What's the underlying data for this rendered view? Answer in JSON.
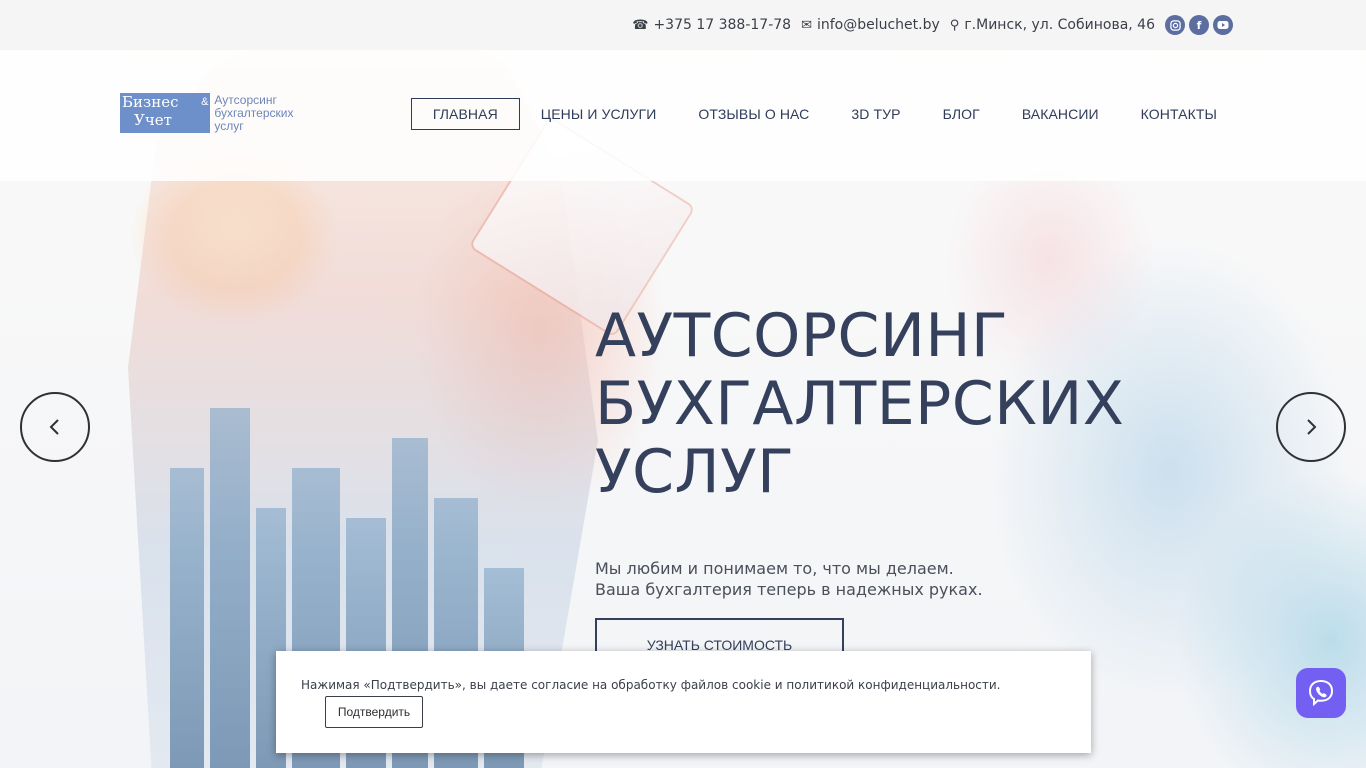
{
  "topbar": {
    "phone": "+375 17 388-17-78",
    "email": "info@beluchet.by",
    "address": "г.Минск, ул. Собинова, 46",
    "social": [
      "instagram-icon",
      "facebook-icon",
      "youtube-icon"
    ]
  },
  "logo": {
    "line1": "Бизнес",
    "amp": "&",
    "line2": "Учет",
    "tagline": "Аутсорсинг бухгалтерских услуг"
  },
  "nav": {
    "items": [
      "ГЛАВНАЯ",
      "ЦЕНЫ И УСЛУГИ",
      "ОТЗЫВЫ О НАС",
      "3D ТУР",
      "БЛОГ",
      "ВАКАНСИИ",
      "КОНТАКТЫ"
    ],
    "active": "ГЛАВНАЯ"
  },
  "hero": {
    "title_line1": "АУТСОРСИНГ",
    "title_line2": "БУХГАЛТЕРСКИХ",
    "title_line3": "УСЛУГ",
    "subtitle_line1": "Мы любим и понимаем то, что мы делаем.",
    "subtitle_line2": "Ваша бухгалтерия теперь в надежных руках.",
    "button": "УЗНАТЬ СТОИМОСТЬ"
  },
  "cookie": {
    "text": "Нажимая «Подтвердить», вы даете согласие на обработку файлов cookie и политикой конфиденциальности.",
    "button": "Подтвердить"
  },
  "colors": {
    "accent": "#34405c",
    "logo_blue": "#6d8fca",
    "social": "#5c6ea0",
    "viber": "#7360f2"
  }
}
